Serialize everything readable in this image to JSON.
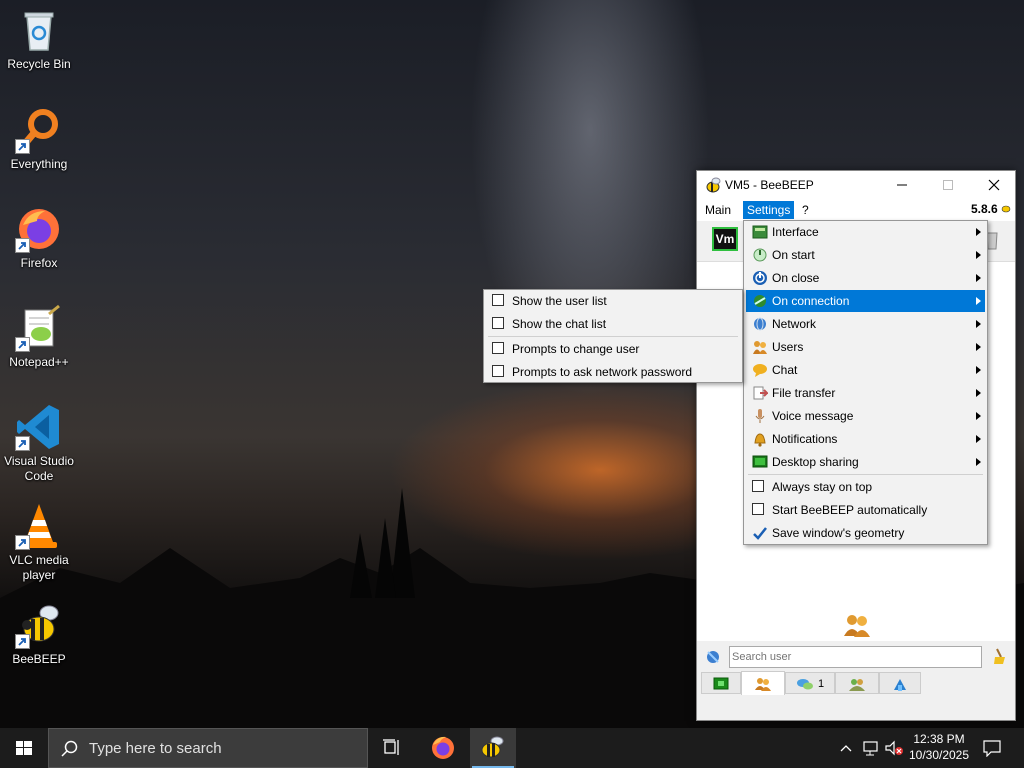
{
  "desktop": {
    "icons": [
      {
        "label": "Recycle Bin"
      },
      {
        "label": "Everything"
      },
      {
        "label": "Firefox"
      },
      {
        "label": "Notepad++"
      },
      {
        "label": "Visual Studio Code"
      },
      {
        "label": "VLC media player"
      },
      {
        "label": "BeeBEEP"
      }
    ]
  },
  "window": {
    "title": "VM5 - BeeBEEP",
    "version": "5.8.6",
    "menubar": [
      "Main",
      "Settings",
      "?"
    ],
    "toolbar_badge": "Vm",
    "search_placeholder": "Search user",
    "tabs": [
      {
        "icon": "chip-icon",
        "label": ""
      },
      {
        "icon": "users-icon",
        "label": ""
      },
      {
        "icon": "chat-icon",
        "label": "1"
      },
      {
        "icon": "group-icon",
        "label": ""
      },
      {
        "icon": "share-icon",
        "label": ""
      }
    ]
  },
  "settings_menu": {
    "items": [
      {
        "label": "Interface",
        "icon": "interface-icon",
        "color": "#3a8a3a",
        "submenu": true
      },
      {
        "label": "On start",
        "icon": "power-on-icon",
        "color": "#7cc07c",
        "submenu": true
      },
      {
        "label": "On close",
        "icon": "power-off-icon",
        "color": "#1a5fb4",
        "submenu": true
      },
      {
        "label": "On connection",
        "icon": "connection-icon",
        "color": "#2e8b2e",
        "submenu": true,
        "highlighted": true
      },
      {
        "label": "Network",
        "icon": "network-icon",
        "color": "#3c7fd0",
        "submenu": true
      },
      {
        "label": "Users",
        "icon": "users-icon",
        "color": "#d48a1e",
        "submenu": true
      },
      {
        "label": "Chat",
        "icon": "chat-icon",
        "color": "#f0b020",
        "submenu": true
      },
      {
        "label": "File transfer",
        "icon": "file-transfer-icon",
        "color": "#c05050",
        "submenu": true
      },
      {
        "label": "Voice message",
        "icon": "voice-icon",
        "color": "#c89060",
        "submenu": true
      },
      {
        "label": "Notifications",
        "icon": "bell-icon",
        "color": "#e0a020",
        "submenu": true
      },
      {
        "label": "Desktop sharing",
        "icon": "desktop-share-icon",
        "color": "#1a7a1a",
        "submenu": true
      }
    ],
    "checkboxes": [
      {
        "label": "Always stay on top",
        "checked": false
      },
      {
        "label": "Start BeeBEEP automatically",
        "checked": false
      },
      {
        "label": "Save window's geometry",
        "checked": true
      }
    ]
  },
  "connection_submenu": {
    "items": [
      {
        "label": "Show the user list",
        "checked": false
      },
      {
        "label": "Show the chat list",
        "checked": false
      },
      {
        "label": "Prompts to change user",
        "checked": false
      },
      {
        "label": "Prompts to ask network password",
        "checked": false
      }
    ]
  },
  "taskbar": {
    "search_placeholder": "Type here to search",
    "time": "12:38 PM",
    "date": "10/30/2025"
  },
  "colors": {
    "accent": "#0078d7",
    "taskbar": "#1c1c1c"
  }
}
